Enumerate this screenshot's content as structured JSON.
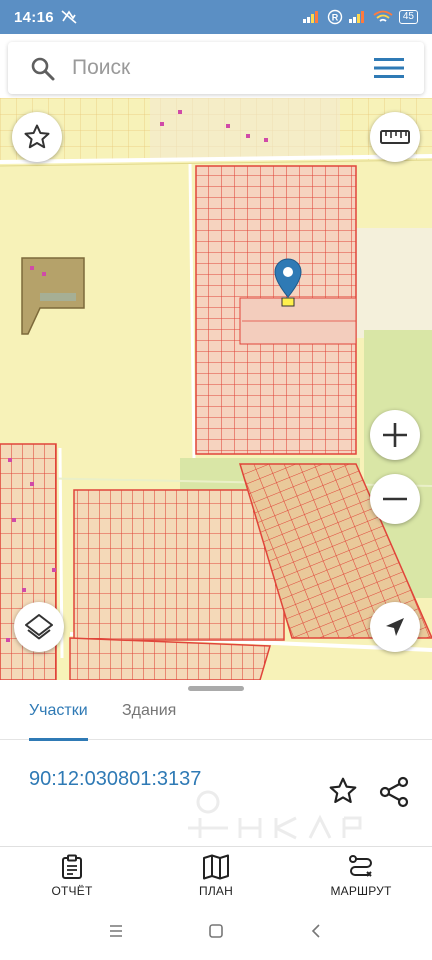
{
  "status_bar": {
    "time": "14:16",
    "battery": "45"
  },
  "search": {
    "placeholder": "Поиск"
  },
  "map": {
    "marker_icon": "location-pin-icon",
    "colors": {
      "background": "#f7f2b8",
      "parcel_stroke": "#e0453a",
      "parcel_fill": "#f6d3bf",
      "green_area": "#d9e6a6",
      "road": "#ffffff"
    },
    "controls": [
      "star-icon",
      "ruler-icon",
      "zoom-in-icon",
      "zoom-out-icon",
      "layers-icon",
      "navigation-arrow-icon"
    ]
  },
  "sheet": {
    "tabs": [
      {
        "label": "Участки",
        "active": true
      },
      {
        "label": "Здания",
        "active": false
      }
    ],
    "cadastral_number": "90:12:030801:3137"
  },
  "bottom_nav": {
    "report": "ОТЧЁТ",
    "plan": "ПЛАН",
    "route": "МАРШРУТ"
  },
  "theme": {
    "accent": "#2f7ab5",
    "status_bar": "#5b8fc4"
  }
}
